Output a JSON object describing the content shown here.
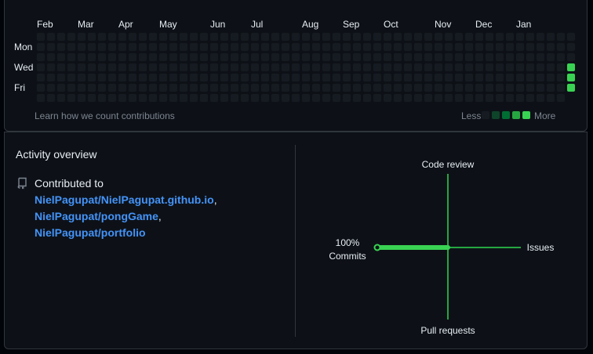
{
  "calendar": {
    "months": [
      "Feb",
      "Mar",
      "Apr",
      "May",
      "Jun",
      "Jul",
      "Aug",
      "Sep",
      "Oct",
      "Nov",
      "Dec",
      "Jan"
    ],
    "weekdays": [
      "Mon",
      "Wed",
      "Fri"
    ],
    "learn_link": "Learn how we count contributions",
    "legend_less": "Less",
    "legend_more": "More",
    "empty_color": "#161b22",
    "level_colors": [
      "#161b22",
      "#0e4429",
      "#006d32",
      "#26a641",
      "#39d353"
    ],
    "active_days": [
      {
        "week": 52,
        "day": 3,
        "level": 4
      },
      {
        "week": 52,
        "day": 4,
        "level": 4
      },
      {
        "week": 52,
        "day": 5,
        "level": 4
      }
    ]
  },
  "activity": {
    "title": "Activity overview",
    "contributed_label": "Contributed to",
    "repos": [
      {
        "name": "NielPagupat/NielPagupat.github.io",
        "sep": ","
      },
      {
        "name": "NielPagupat/pongGame",
        "sep": ","
      },
      {
        "name": "NielPagupat/portfolio",
        "sep": ""
      }
    ]
  },
  "axes": {
    "code_review": "Code review",
    "issues": "Issues",
    "pull_requests": "Pull requests",
    "commits_percent": "100%",
    "commits": "Commits",
    "commits_value": 100,
    "line_color": "#26a641",
    "highlight_color": "#39d353"
  }
}
